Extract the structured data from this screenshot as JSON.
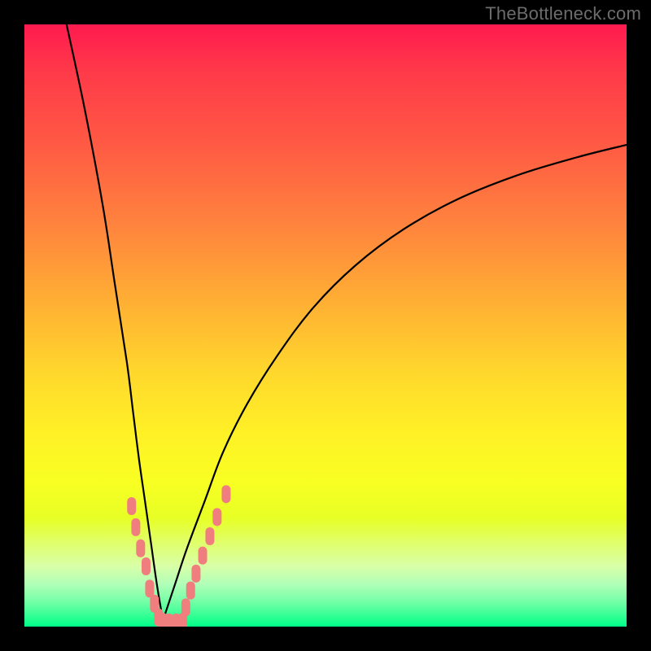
{
  "watermark": "TheBottleneck.com",
  "colors": {
    "frame": "#000000",
    "curve": "#000000",
    "marker_fill": "#f07e7e",
    "marker_stroke": "#f07e7e",
    "gradient_top": "#ff1a4f",
    "gradient_bottom": "#00ff88"
  },
  "chart_data": {
    "type": "line",
    "title": "",
    "xlabel": "",
    "ylabel": "",
    "xlim": [
      0,
      100
    ],
    "ylim": [
      0,
      100
    ],
    "grid": false,
    "legend": false,
    "description": "Two-sided curve with a sharp valley near x≈23 where value ≈ 0 (green / no bottleneck), rising steeply to ~100 (red / severe bottleneck) on both sides. Left branch is near-vertical; right branch rises with decreasing slope.",
    "series": [
      {
        "name": "bottleneck-left",
        "x": [
          7,
          10,
          13,
          15,
          17,
          18,
          19,
          20,
          21,
          22,
          23
        ],
        "values": [
          100,
          86,
          70,
          57,
          44,
          36,
          28,
          21,
          14,
          7,
          1
        ]
      },
      {
        "name": "bottleneck-right",
        "x": [
          23,
          25,
          27,
          30,
          33,
          37,
          42,
          48,
          55,
          63,
          72,
          82,
          92,
          100
        ],
        "values": [
          1,
          7,
          13,
          21,
          29,
          37,
          45,
          53,
          60,
          66,
          71,
          75,
          78,
          80
        ]
      }
    ],
    "annotations": [
      {
        "name": "markers-left-branch",
        "x": [
          17.8,
          18.5,
          19.3,
          20.2,
          20.8,
          21.6,
          22.3
        ],
        "values": [
          20.0,
          16.5,
          13.0,
          10.0,
          6.3,
          3.8,
          1.5
        ]
      },
      {
        "name": "markers-valley",
        "x": [
          23.0,
          24.0,
          25.2,
          26.3
        ],
        "values": [
          0.8,
          0.7,
          0.7,
          0.8
        ]
      },
      {
        "name": "markers-right-branch",
        "x": [
          26.8,
          27.6,
          28.5,
          29.6,
          30.8,
          32.0,
          33.5
        ],
        "values": [
          3.2,
          6.0,
          8.8,
          11.8,
          15.0,
          18.2,
          22.0
        ]
      }
    ]
  }
}
